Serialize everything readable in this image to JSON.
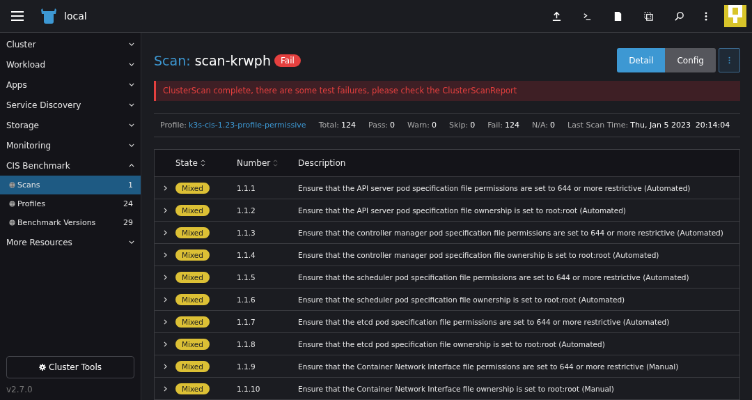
{
  "header": {
    "cluster": "local"
  },
  "sidebar": {
    "items": [
      {
        "label": "Cluster",
        "expanded": false
      },
      {
        "label": "Workload",
        "expanded": false
      },
      {
        "label": "Apps",
        "expanded": false
      },
      {
        "label": "Service Discovery",
        "expanded": false
      },
      {
        "label": "Storage",
        "expanded": false
      },
      {
        "label": "Monitoring",
        "expanded": false
      },
      {
        "label": "CIS Benchmark",
        "expanded": true,
        "children": [
          {
            "label": "Scans",
            "count": "1",
            "selected": true
          },
          {
            "label": "Profiles",
            "count": "24",
            "selected": false
          },
          {
            "label": "Benchmark Versions",
            "count": "29",
            "selected": false
          }
        ]
      },
      {
        "label": "More Resources",
        "expanded": false
      }
    ],
    "tools_button": "Cluster Tools",
    "version": "v2.7.0"
  },
  "page": {
    "title_prefix": "Scan:",
    "title": "scan-krwph",
    "badge": "Fail",
    "view_tabs": [
      {
        "label": "Detail",
        "selected": true
      },
      {
        "label": "Config",
        "selected": false
      }
    ],
    "banner": "ClusterScan complete, there are some test failures, please check the ClusterScanReport",
    "stats": [
      {
        "label": "Profile:",
        "value": "k3s-cis-1.23-profile-permissive",
        "kind": "link"
      },
      {
        "label": "Total:",
        "value": "124",
        "kind": "text"
      },
      {
        "label": "Pass:",
        "value": "0",
        "kind": "text"
      },
      {
        "label": "Warn:",
        "value": "0",
        "kind": "text"
      },
      {
        "label": "Skip:",
        "value": "0",
        "kind": "text"
      },
      {
        "label": "Fail:",
        "value": "124",
        "kind": "text"
      },
      {
        "label": "N/A:",
        "value": "0",
        "kind": "text"
      },
      {
        "label": "Last Scan Time:",
        "value": "Thu, Jan 5 2023  20:14:04",
        "kind": "text"
      }
    ]
  },
  "table": {
    "columns": [
      "State",
      "Number",
      "Description"
    ],
    "rows": [
      {
        "state": "Mixed",
        "number": "1.1.1",
        "description": "Ensure that the API server pod specification file permissions are set to 644 or more restrictive (Automated)"
      },
      {
        "state": "Mixed",
        "number": "1.1.2",
        "description": "Ensure that the API server pod specification file ownership is set to root:root (Automated)"
      },
      {
        "state": "Mixed",
        "number": "1.1.3",
        "description": "Ensure that the controller manager pod specification file permissions are set to 644 or more restrictive (Automated)"
      },
      {
        "state": "Mixed",
        "number": "1.1.4",
        "description": "Ensure that the controller manager pod specification file ownership is set to root:root (Automated)"
      },
      {
        "state": "Mixed",
        "number": "1.1.5",
        "description": "Ensure that the scheduler pod specification file permissions are set to 644 or more restrictive (Automated)"
      },
      {
        "state": "Mixed",
        "number": "1.1.6",
        "description": "Ensure that the scheduler pod specification file ownership is set to root:root (Automated)"
      },
      {
        "state": "Mixed",
        "number": "1.1.7",
        "description": "Ensure that the etcd pod specification file permissions are set to 644 or more restrictive (Automated)"
      },
      {
        "state": "Mixed",
        "number": "1.1.8",
        "description": "Ensure that the etcd pod specification file ownership is set to root:root (Automated)"
      },
      {
        "state": "Mixed",
        "number": "1.1.9",
        "description": "Ensure that the Container Network Interface file permissions are set to 644 or more restrictive (Manual)"
      },
      {
        "state": "Mixed",
        "number": "1.1.10",
        "description": "Ensure that the Container Network Interface file ownership is set to root:root (Manual)"
      }
    ]
  }
}
